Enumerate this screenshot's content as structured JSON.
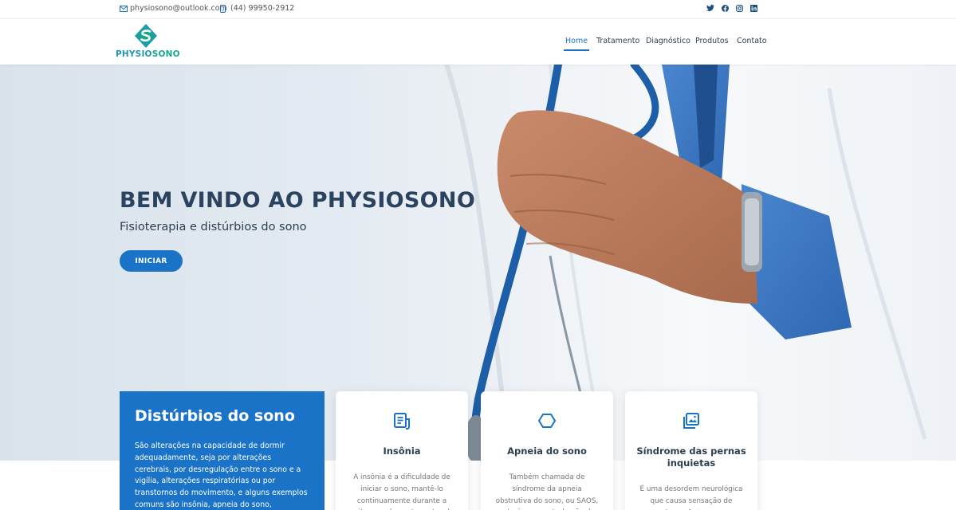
{
  "topbar": {
    "email": "physiosono@outlook.com",
    "phone": "(44) 99950-2912",
    "social_icons": [
      "twitter-icon",
      "facebook-icon",
      "instagram-icon",
      "linkedin-icon"
    ]
  },
  "header": {
    "logo_text_1": "PHYSIO",
    "logo_text_2": "SONO",
    "nav": [
      {
        "label": "Home",
        "active": true
      },
      {
        "label": "Tratamento",
        "active": false
      },
      {
        "label": "Diagnóstico",
        "active": false
      },
      {
        "label": "Produtos",
        "active": false
      },
      {
        "label": "Contato",
        "active": false
      }
    ]
  },
  "hero": {
    "title": "BEM VINDO AO PHYSIOSONO",
    "subtitle": "Fisioterapia e distúrbios do sono",
    "button": "INICIAR"
  },
  "intro": {
    "title": "Distúrbios do sono",
    "text": "São alterações na capacidade de dormir adequadamente, seja por alterações cerebrais, por desregulação entre o sono e a vigília, alterações respiratórias ou por transtornos do movimento, e alguns exemplos comuns são insônia, apneia do sono, narcolepsia,"
  },
  "cards": [
    {
      "title": "Insônia",
      "icon": "document-icon",
      "text": "A insônia é a dificuldade de iniciar o sono, mantê-lo continuamente durante a noite ou o despertar antes do"
    },
    {
      "title": "Apneia do sono",
      "icon": "hexagon-icon",
      "text": "Também chamada de síndrome da apneia obstrutiva do sono, ou SAOS, esta é uma perturbação do"
    },
    {
      "title": "Síndrome das pernas inquietas",
      "icon": "image-icon",
      "text": "É uma desordem neurológica que causa sensação de desconforto nas"
    }
  ],
  "colors": {
    "accent": "#1a73c7",
    "title_dark": "#2c4360",
    "logo_teal": "#1e98b3",
    "logo_green": "#15a88d"
  }
}
